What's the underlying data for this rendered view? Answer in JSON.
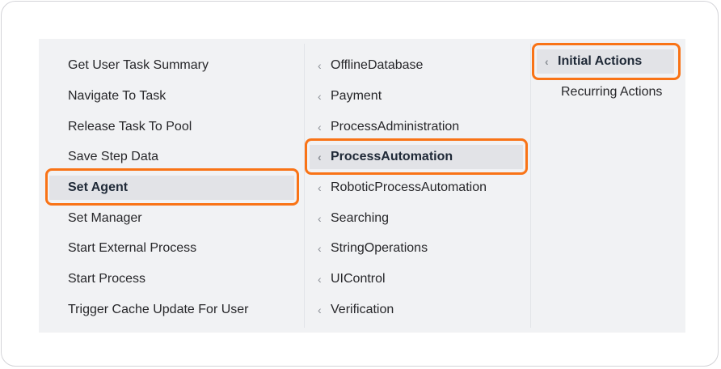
{
  "column1": {
    "items": [
      {
        "label": "Get User Task Summary"
      },
      {
        "label": "Navigate To Task"
      },
      {
        "label": "Release Task To Pool"
      },
      {
        "label": "Save Step Data"
      },
      {
        "label": "Set Agent",
        "selected": true
      },
      {
        "label": "Set Manager"
      },
      {
        "label": "Start External Process"
      },
      {
        "label": "Start Process"
      },
      {
        "label": "Trigger Cache Update For User"
      }
    ]
  },
  "column2": {
    "chevron_icon": "chevron-left-icon",
    "items": [
      {
        "label": "OfflineDatabase"
      },
      {
        "label": "Payment"
      },
      {
        "label": "ProcessAdministration"
      },
      {
        "label": "ProcessAutomation",
        "selected": true
      },
      {
        "label": "RoboticProcessAutomation"
      },
      {
        "label": "Searching"
      },
      {
        "label": "StringOperations"
      },
      {
        "label": "UIControl"
      },
      {
        "label": "Verification"
      }
    ]
  },
  "column3": {
    "items": [
      {
        "label": "Initial Actions",
        "selected": true
      },
      {
        "label": "Recurring Actions"
      }
    ]
  },
  "colors": {
    "highlight": "#f97316",
    "panel_background": "#f1f2f4",
    "selected_background": "#e2e3e7"
  }
}
